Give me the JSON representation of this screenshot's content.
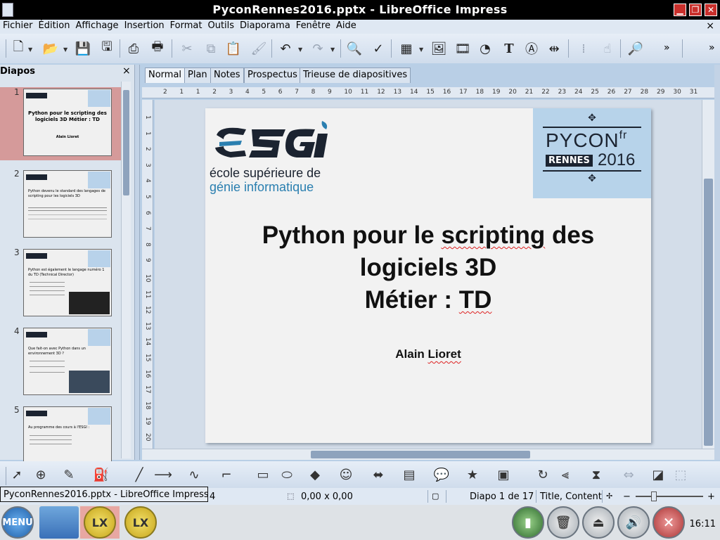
{
  "window": {
    "title": "PyconRennes2016.pptx - LibreOffice Impress"
  },
  "menubar": {
    "items": [
      "Fichier",
      "Édition",
      "Affichage",
      "Insertion",
      "Format",
      "Outils",
      "Diaporama",
      "Fenêtre",
      "Aide"
    ],
    "close": "×"
  },
  "toolbar": {
    "overflow": "»",
    "overflow2": "»"
  },
  "slides_pane": {
    "header": "Diapos",
    "close": "×",
    "thumbs": [
      {
        "num": "1",
        "title": "Python pour le scripting des logiciels 3D Métier : TD",
        "author": "Alain Lioret"
      },
      {
        "num": "2",
        "title": "Python devenu le standard des langages de scripting pour les logiciels 3D"
      },
      {
        "num": "3",
        "title": "Python est également le langage numéro 1 du TD (Technical Director)"
      },
      {
        "num": "4",
        "title": "Que fait-on avec Python dans un environnement 3D ?"
      },
      {
        "num": "5",
        "title": "Au programme des cours à l'ESGI :"
      }
    ]
  },
  "tabs": [
    "Normal",
    "Plan",
    "Notes",
    "Prospectus",
    "Trieuse de diapositives"
  ],
  "slide": {
    "logo_text": "ESGI",
    "logo_line1": "école supérieure de",
    "logo_line2": "génie informatique",
    "badge_top": "PYCON",
    "badge_fr": "fr",
    "badge_city": "RENNES",
    "badge_year": "2016",
    "title_line1_a": "Python pour le ",
    "title_line1_b": "scripting",
    "title_line1_c": " des",
    "title_line2": "logiciels 3D",
    "title_line3_a": "Métier : ",
    "title_line3_b": "TD",
    "author_a": "Alain ",
    "author_b": "Lioret"
  },
  "ruler": {
    "h_ticks": [
      "2",
      "1",
      "1",
      "2",
      "3",
      "4",
      "5",
      "6",
      "7",
      "8",
      "9",
      "10",
      "11",
      "12",
      "13",
      "14",
      "15",
      "16",
      "17",
      "18",
      "19",
      "20",
      "21",
      "22",
      "23",
      "24",
      "25",
      "26",
      "27",
      "28",
      "29",
      "30",
      "31"
    ],
    "v_ticks": [
      "1",
      "1",
      "2",
      "3",
      "4",
      "5",
      "6",
      "7",
      "8",
      "9",
      "10",
      "11",
      "12",
      "13",
      "14",
      "15",
      "16",
      "17",
      "18",
      "19",
      "20",
      "21"
    ]
  },
  "statusbar": {
    "tooltip": "PyconRennes2016.pptx - LibreOffice Impress",
    "pos_suffix": "4",
    "size": "0,00 x 0,00",
    "slide": "Diapo 1 de 17",
    "layout": "Title, Content"
  },
  "taskbar": {
    "menu": "MENU",
    "lx1": "LX",
    "lx2": "LX",
    "clock": "16:11"
  },
  "colors": {
    "accent": "#b7d3ea",
    "selection": "#d59a9a",
    "brand_dark": "#1b2330",
    "brand_teal": "#2a7fb0"
  }
}
